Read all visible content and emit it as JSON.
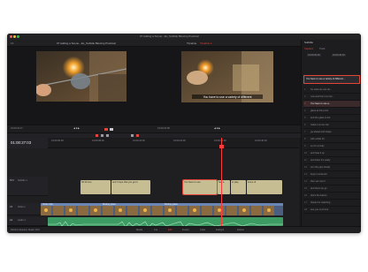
{
  "app": {
    "name": "DaVinci Resolve Studio 18.6",
    "project_title": "07 Adding a Scene - Ex_Subtitle Blowing Practical",
    "colors": {
      "accent_red": "#e0463a",
      "playhead": "#ff3b3b",
      "video_clip": "#6a86b5",
      "audio_clip": "#3c9a63",
      "subtitle_clip": "#c7bd92"
    }
  },
  "source_viewer": {
    "label": "07 Adding a Scene - Ex_Subtitle Blowing Practical",
    "zoom": "Fit",
    "timecode": "01:00:22:17"
  },
  "timeline_viewer": {
    "label": "Timeline",
    "title": "Timeline 1",
    "subtitle_overlay": "You have to use a variety of different",
    "timecode": "01:00:23:08"
  },
  "timeline": {
    "timecode": "01:00:27:03",
    "ruler_marks": [
      "01:00:00:00",
      "01:00:08:00",
      "01:00:16:00",
      "01:00:24:00",
      "01:00:32:00",
      "01:00:40:00"
    ],
    "tracks": [
      {
        "id": "ST1",
        "name": "Subtitle 1"
      },
      {
        "id": "V1",
        "name": "Video 1"
      },
      {
        "id": "A1",
        "name": "Audio 1"
      }
    ],
    "subtitle_clips": [
      "00:10 one",
      "and I hope that you get it",
      "You have to use",
      "has a",
      "to play",
      "some of"
    ],
    "video_clips": [
      "Video Clip",
      "Boding glass",
      "Boding glass"
    ]
  },
  "inspector": {
    "title": "Subtitle",
    "tabs": [
      "Captions",
      "Track"
    ],
    "start_tc": "01:00:00:00",
    "end_tc": "01:00:46:16",
    "selected_caption": "You have to use a variety of different...",
    "captions": [
      {
        "n": "1",
        "text": "So what we can do..."
      },
      {
        "n": "2",
        "text": "now and then cut into..."
      },
      {
        "n": "3",
        "text": "You have to use a..."
      },
      {
        "n": "4",
        "text": "glass at this point"
      },
      {
        "n": "5",
        "text": "and the glass is hot"
      },
      {
        "n": "6",
        "text": "make it so we can"
      },
      {
        "n": "7",
        "text": "go ahead and shape"
      },
      {
        "n": "8",
        "text": "with a little bit"
      },
      {
        "n": "9",
        "text": "so it's a tricky"
      },
      {
        "n": "10",
        "text": "and heat it up"
      },
      {
        "n": "11",
        "text": "and when it's ready"
      },
      {
        "n": "12",
        "text": "turn the pipe slowly"
      },
      {
        "n": "13",
        "text": "keep it centered"
      },
      {
        "n": "14",
        "text": "then we cool it"
      },
      {
        "n": "15",
        "text": "and there we go"
      },
      {
        "n": "16",
        "text": "that's the basics"
      },
      {
        "n": "17",
        "text": "thanks for watching"
      },
      {
        "n": "18",
        "text": "see you next time"
      }
    ]
  },
  "pages": [
    "Media",
    "Cut",
    "Edit",
    "Fusion",
    "Color",
    "Fairlight",
    "Deliver"
  ]
}
